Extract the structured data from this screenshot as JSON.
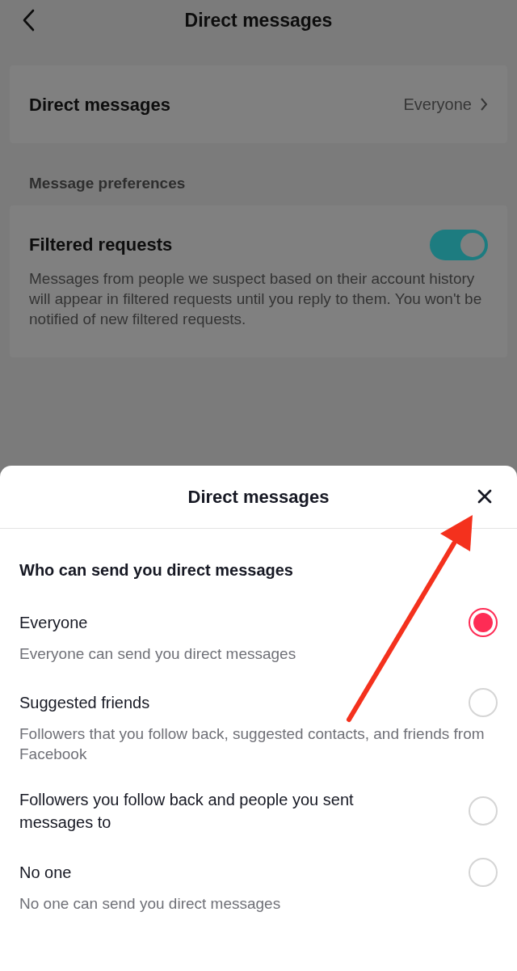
{
  "top_bar": {
    "title": "Direct messages"
  },
  "direct_messages_row": {
    "label": "Direct messages",
    "value": "Everyone"
  },
  "section_header": "Message preferences",
  "filtered_requests": {
    "label": "Filtered requests",
    "on": true,
    "description": "Messages from people we suspect based on their account history will appear in filtered requests until you reply to them. You won't be notified of new filtered requests."
  },
  "sheet": {
    "title": "Direct messages",
    "question": "Who can send you direct messages",
    "options": [
      {
        "label": "Everyone",
        "description": "Everyone can send you direct messages",
        "selected": true
      },
      {
        "label": "Suggested friends",
        "description": "Followers that you follow back, suggested contacts, and friends from Facebook",
        "selected": false
      },
      {
        "label": "Followers you follow back and people you sent messages to",
        "selected": false
      },
      {
        "label": "No one",
        "description": "No one can send you direct messages",
        "selected": false
      }
    ]
  }
}
